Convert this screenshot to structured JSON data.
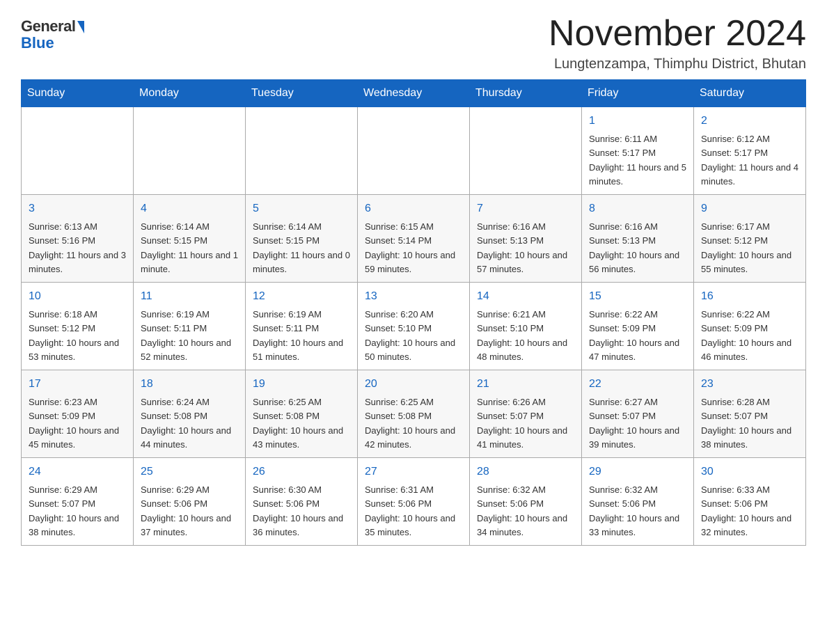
{
  "header": {
    "logo": {
      "general": "General",
      "blue": "Blue"
    },
    "title": "November 2024",
    "location": "Lungtenzampa, Thimphu District, Bhutan"
  },
  "weekdays": [
    "Sunday",
    "Monday",
    "Tuesday",
    "Wednesday",
    "Thursday",
    "Friday",
    "Saturday"
  ],
  "weeks": [
    [
      {
        "day": "",
        "info": ""
      },
      {
        "day": "",
        "info": ""
      },
      {
        "day": "",
        "info": ""
      },
      {
        "day": "",
        "info": ""
      },
      {
        "day": "",
        "info": ""
      },
      {
        "day": "1",
        "info": "Sunrise: 6:11 AM\nSunset: 5:17 PM\nDaylight: 11 hours and 5 minutes."
      },
      {
        "day": "2",
        "info": "Sunrise: 6:12 AM\nSunset: 5:17 PM\nDaylight: 11 hours and 4 minutes."
      }
    ],
    [
      {
        "day": "3",
        "info": "Sunrise: 6:13 AM\nSunset: 5:16 PM\nDaylight: 11 hours and 3 minutes."
      },
      {
        "day": "4",
        "info": "Sunrise: 6:14 AM\nSunset: 5:15 PM\nDaylight: 11 hours and 1 minute."
      },
      {
        "day": "5",
        "info": "Sunrise: 6:14 AM\nSunset: 5:15 PM\nDaylight: 11 hours and 0 minutes."
      },
      {
        "day": "6",
        "info": "Sunrise: 6:15 AM\nSunset: 5:14 PM\nDaylight: 10 hours and 59 minutes."
      },
      {
        "day": "7",
        "info": "Sunrise: 6:16 AM\nSunset: 5:13 PM\nDaylight: 10 hours and 57 minutes."
      },
      {
        "day": "8",
        "info": "Sunrise: 6:16 AM\nSunset: 5:13 PM\nDaylight: 10 hours and 56 minutes."
      },
      {
        "day": "9",
        "info": "Sunrise: 6:17 AM\nSunset: 5:12 PM\nDaylight: 10 hours and 55 minutes."
      }
    ],
    [
      {
        "day": "10",
        "info": "Sunrise: 6:18 AM\nSunset: 5:12 PM\nDaylight: 10 hours and 53 minutes."
      },
      {
        "day": "11",
        "info": "Sunrise: 6:19 AM\nSunset: 5:11 PM\nDaylight: 10 hours and 52 minutes."
      },
      {
        "day": "12",
        "info": "Sunrise: 6:19 AM\nSunset: 5:11 PM\nDaylight: 10 hours and 51 minutes."
      },
      {
        "day": "13",
        "info": "Sunrise: 6:20 AM\nSunset: 5:10 PM\nDaylight: 10 hours and 50 minutes."
      },
      {
        "day": "14",
        "info": "Sunrise: 6:21 AM\nSunset: 5:10 PM\nDaylight: 10 hours and 48 minutes."
      },
      {
        "day": "15",
        "info": "Sunrise: 6:22 AM\nSunset: 5:09 PM\nDaylight: 10 hours and 47 minutes."
      },
      {
        "day": "16",
        "info": "Sunrise: 6:22 AM\nSunset: 5:09 PM\nDaylight: 10 hours and 46 minutes."
      }
    ],
    [
      {
        "day": "17",
        "info": "Sunrise: 6:23 AM\nSunset: 5:09 PM\nDaylight: 10 hours and 45 minutes."
      },
      {
        "day": "18",
        "info": "Sunrise: 6:24 AM\nSunset: 5:08 PM\nDaylight: 10 hours and 44 minutes."
      },
      {
        "day": "19",
        "info": "Sunrise: 6:25 AM\nSunset: 5:08 PM\nDaylight: 10 hours and 43 minutes."
      },
      {
        "day": "20",
        "info": "Sunrise: 6:25 AM\nSunset: 5:08 PM\nDaylight: 10 hours and 42 minutes."
      },
      {
        "day": "21",
        "info": "Sunrise: 6:26 AM\nSunset: 5:07 PM\nDaylight: 10 hours and 41 minutes."
      },
      {
        "day": "22",
        "info": "Sunrise: 6:27 AM\nSunset: 5:07 PM\nDaylight: 10 hours and 39 minutes."
      },
      {
        "day": "23",
        "info": "Sunrise: 6:28 AM\nSunset: 5:07 PM\nDaylight: 10 hours and 38 minutes."
      }
    ],
    [
      {
        "day": "24",
        "info": "Sunrise: 6:29 AM\nSunset: 5:07 PM\nDaylight: 10 hours and 38 minutes."
      },
      {
        "day": "25",
        "info": "Sunrise: 6:29 AM\nSunset: 5:06 PM\nDaylight: 10 hours and 37 minutes."
      },
      {
        "day": "26",
        "info": "Sunrise: 6:30 AM\nSunset: 5:06 PM\nDaylight: 10 hours and 36 minutes."
      },
      {
        "day": "27",
        "info": "Sunrise: 6:31 AM\nSunset: 5:06 PM\nDaylight: 10 hours and 35 minutes."
      },
      {
        "day": "28",
        "info": "Sunrise: 6:32 AM\nSunset: 5:06 PM\nDaylight: 10 hours and 34 minutes."
      },
      {
        "day": "29",
        "info": "Sunrise: 6:32 AM\nSunset: 5:06 PM\nDaylight: 10 hours and 33 minutes."
      },
      {
        "day": "30",
        "info": "Sunrise: 6:33 AM\nSunset: 5:06 PM\nDaylight: 10 hours and 32 minutes."
      }
    ]
  ]
}
